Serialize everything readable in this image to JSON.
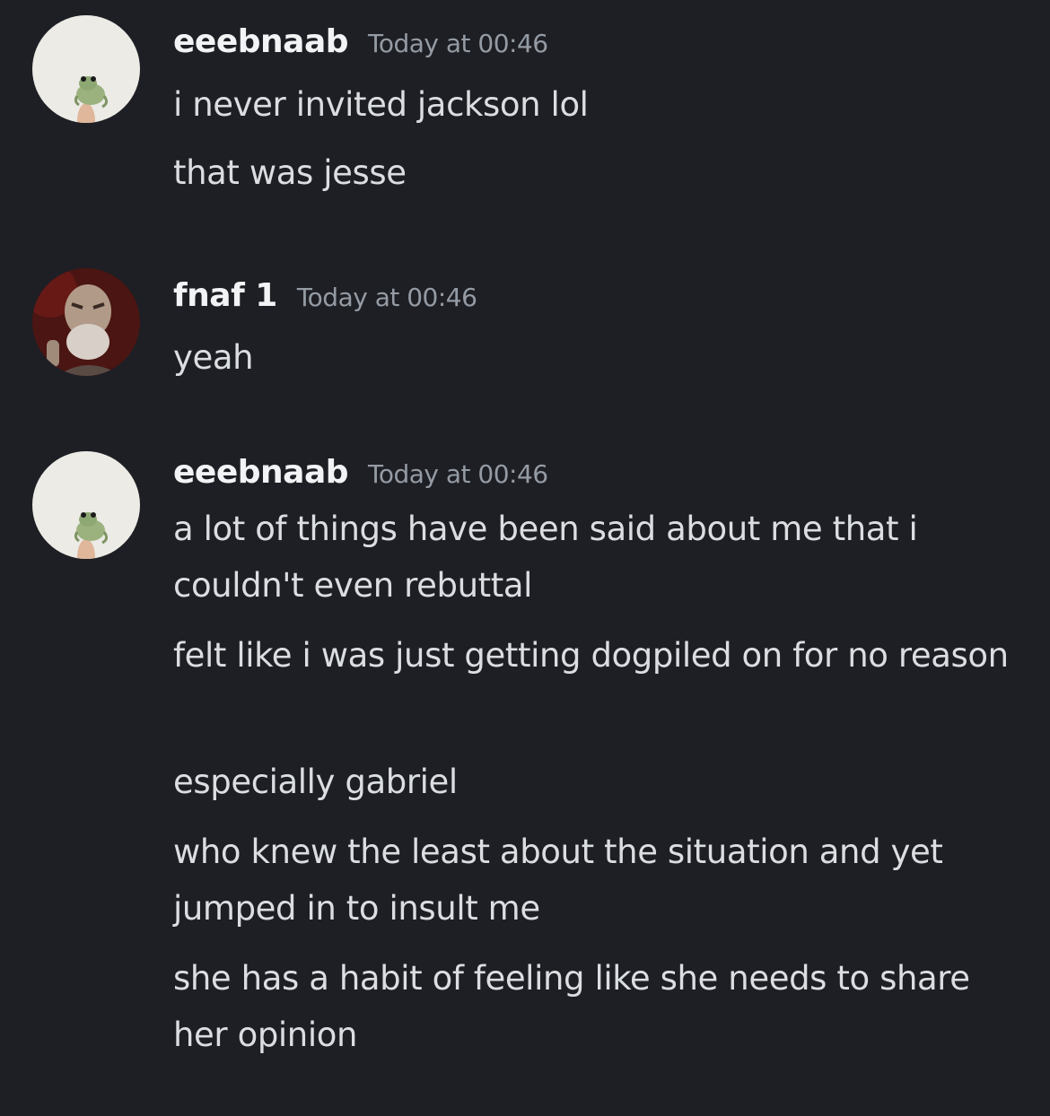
{
  "messages": [
    {
      "author": "eeebnaab",
      "timestamp": "Today at 00:46",
      "avatar": "frog-avatar",
      "lines": [
        "i never invited jackson lol",
        "that was jesse"
      ]
    },
    {
      "author": "fnaf 1",
      "timestamp": "Today at 00:46",
      "avatar": "bearded-man-avatar",
      "lines": [
        "yeah"
      ]
    },
    {
      "author": "eeebnaab",
      "timestamp": "Today at 00:46",
      "avatar": "frog-avatar",
      "lines": [
        "a lot of things have been said about me that i couldn't even rebuttal",
        "felt like i was just getting dogpiled on for no reason",
        "especially gabriel",
        "who knew the least about the situation and yet jumped in to insult me",
        "she has a habit of feeling like she needs to share her opinion"
      ]
    }
  ],
  "colors": {
    "background": "#1e1f24",
    "username": "#f2f3f5",
    "timestamp": "#949ba4",
    "message_text": "#dbdee1"
  }
}
